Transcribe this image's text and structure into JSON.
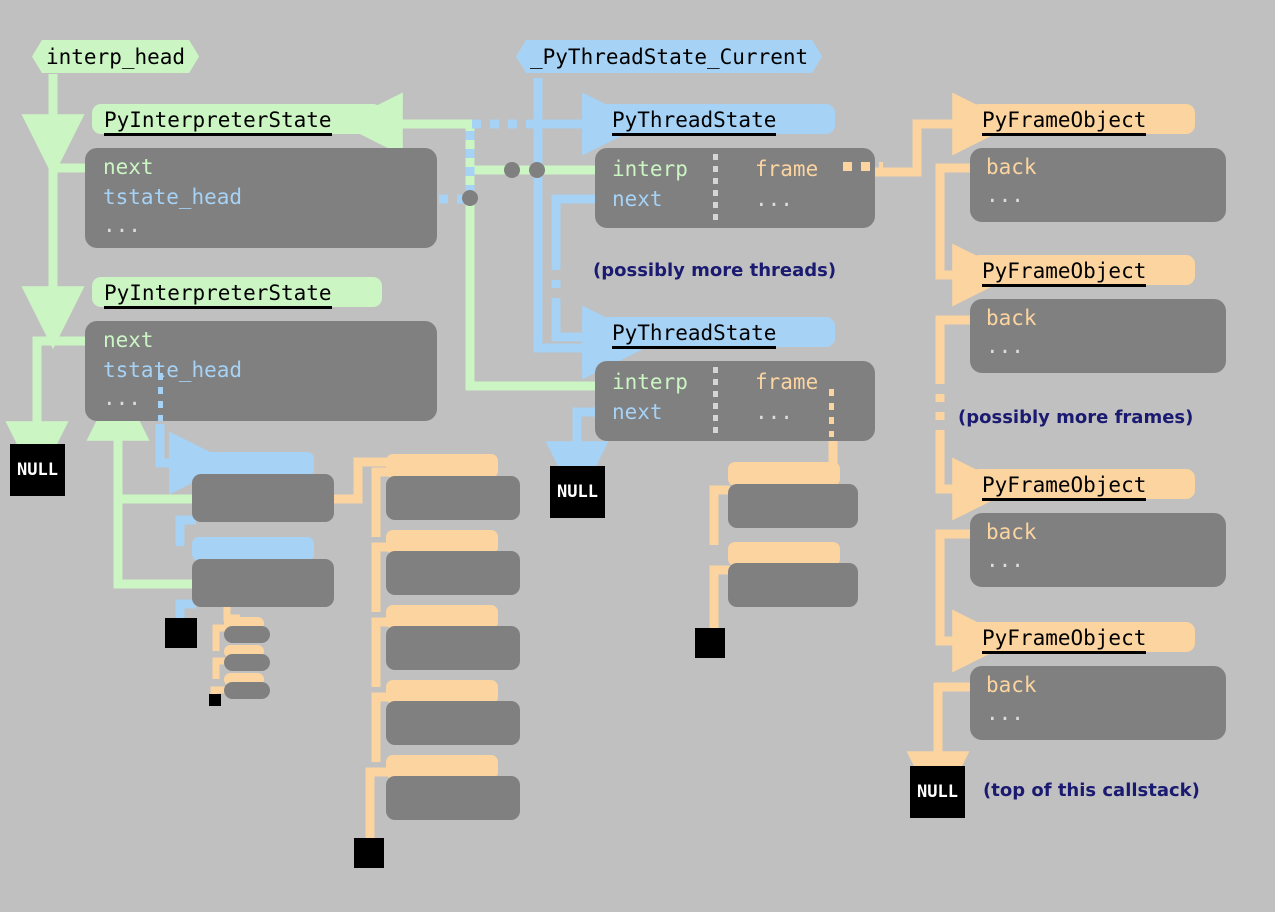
{
  "diagram": {
    "title": "CPython interpreter / thread / frame object graph",
    "background_color": "#c0c0c0",
    "palette": {
      "interpreter_green": "#ccf5c4",
      "thread_blue": "#a6d2f5",
      "frame_orange": "#fbd4a0",
      "body_grey": "#808080",
      "null_black": "#000000",
      "note_navy": "#1a1a70"
    }
  },
  "tags": {
    "interp_head": "interp_head",
    "pythreadstate_current": "_PyThreadState_Current"
  },
  "interpreters": [
    {
      "header": "PyInterpreterState",
      "fields": {
        "next": "next",
        "tstate_head": "tstate_head",
        "more": "..."
      }
    },
    {
      "header": "PyInterpreterState",
      "fields": {
        "next": "next",
        "tstate_head": "tstate_head",
        "more": "..."
      }
    }
  ],
  "threads": [
    {
      "header": "PyThreadState",
      "fields": {
        "interp": "interp",
        "next": "next",
        "frame": "frame",
        "more": "..."
      }
    },
    {
      "header": "PyThreadState",
      "fields": {
        "interp": "interp",
        "next": "next",
        "frame": "frame",
        "more": "..."
      }
    }
  ],
  "frames": [
    {
      "header": "PyFrameObject",
      "fields": {
        "back": "back",
        "more": "..."
      }
    },
    {
      "header": "PyFrameObject",
      "fields": {
        "back": "back",
        "more": "..."
      }
    },
    {
      "header": "PyFrameObject",
      "fields": {
        "back": "back",
        "more": "..."
      }
    },
    {
      "header": "PyFrameObject",
      "fields": {
        "back": "back",
        "more": "..."
      }
    }
  ],
  "nulls": {
    "interp_chain_end": "NULL",
    "thread_chain_end": "NULL",
    "frame_chain_end": "NULL"
  },
  "notes": {
    "more_threads": "(possibly more threads)",
    "more_frames": "(possibly more frames)",
    "top_of_callstack": "(top of this callstack)"
  },
  "icons": {
    "arrow_head": "arrowhead-icon",
    "junction_dot": "junction-dot-icon",
    "dotted_link": "dotted-link-icon"
  }
}
